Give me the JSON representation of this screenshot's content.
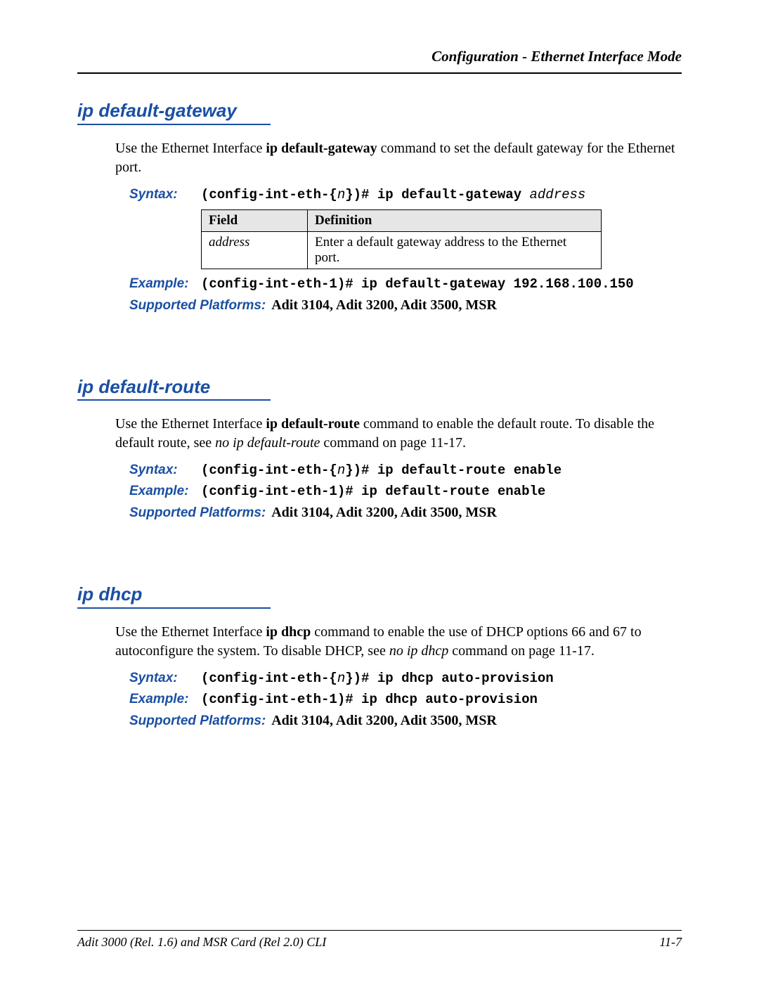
{
  "header": {
    "running_head": "Configuration - Ethernet Interface Mode"
  },
  "sections": {
    "s1": {
      "title": "ip default-gateway",
      "intro_pre": "Use the Ethernet Interface ",
      "intro_cmd": "ip default-gateway",
      "intro_post": " command to set the default gateway for the Ethernet port.",
      "syntax_label": "Syntax:",
      "syntax_prompt": "(config-int-eth-{",
      "syntax_n": "n",
      "syntax_prompt2": "})# ip default-gateway ",
      "syntax_arg": "address",
      "table": {
        "h1": "Field",
        "h2": "Definition",
        "r1c1": "address",
        "r1c2": "Enter a default gateway address to the Ethernet port."
      },
      "example_label": "Example:",
      "example_text": "(config-int-eth-1)# ip default-gateway 192.168.100.150",
      "platforms_label": "Supported Platforms:",
      "platforms_text": "Adit 3104, Adit 3200, Adit 3500, MSR"
    },
    "s2": {
      "title": "ip default-route",
      "intro_pre": "Use the Ethernet Interface ",
      "intro_cmd": "ip default-route",
      "intro_post1": " command to enable the default route. To disable the default route, see ",
      "intro_ref": "no ip default-route",
      "intro_post2": " command on page 11-17.",
      "syntax_label": "Syntax:",
      "syntax_prompt": "(config-int-eth-{",
      "syntax_n": "n",
      "syntax_prompt2": "})# ip default-route enable",
      "example_label": "Example:",
      "example_text": "(config-int-eth-1)# ip default-route enable",
      "platforms_label": "Supported Platforms:",
      "platforms_text": "Adit 3104, Adit 3200, Adit 3500, MSR"
    },
    "s3": {
      "title": "ip dhcp",
      "intro_pre": "Use the Ethernet Interface ",
      "intro_cmd": "ip dhcp",
      "intro_post1": " command to enable the use of DHCP options 66 and 67 to autoconfigure the system. To disable DHCP, see ",
      "intro_ref": "no ip dhcp",
      "intro_post2": " command on page 11-17.",
      "syntax_label": "Syntax:",
      "syntax_prompt": "(config-int-eth-{",
      "syntax_n": "n",
      "syntax_prompt2": "})# ip dhcp auto-provision",
      "example_label": "Example:",
      "example_text": "(config-int-eth-1)# ip dhcp auto-provision",
      "platforms_label": "Supported Platforms:",
      "platforms_text": "Adit 3104, Adit 3200, Adit 3500, MSR"
    }
  },
  "footer": {
    "left": "Adit 3000 (Rel. 1.6) and MSR Card (Rel 2.0) CLI",
    "right": "11-7"
  }
}
